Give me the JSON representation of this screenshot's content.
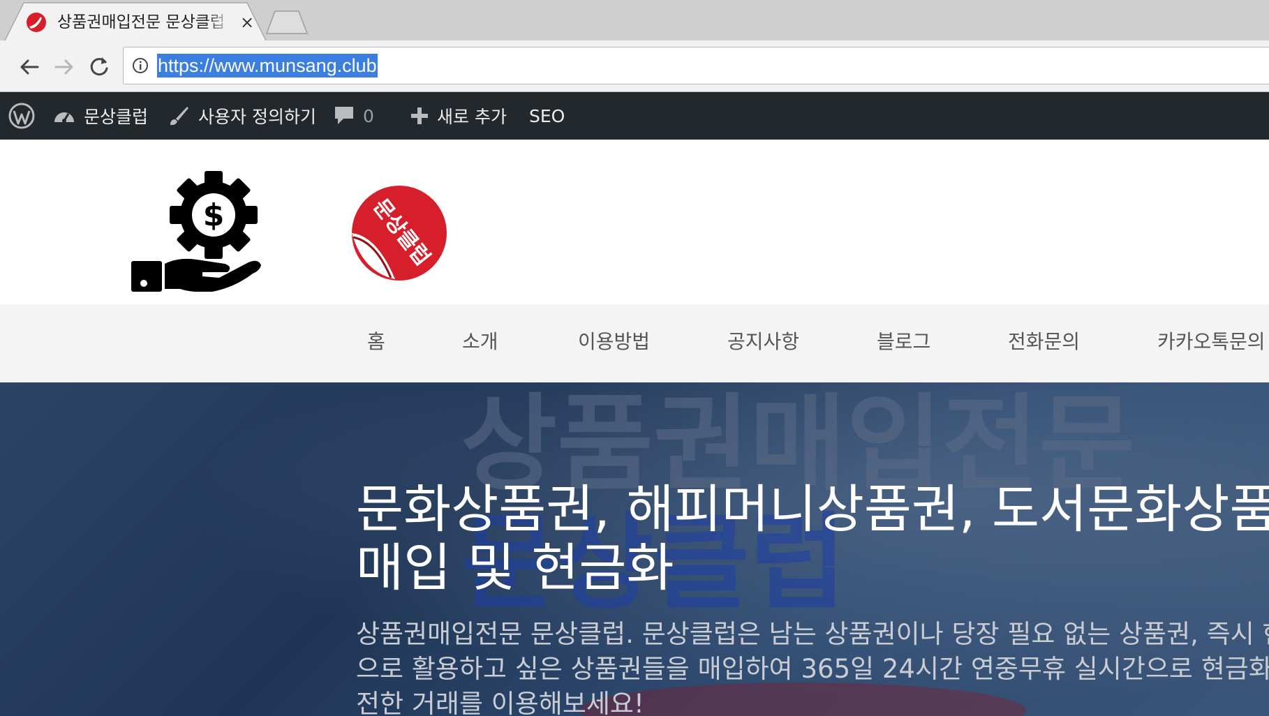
{
  "browser": {
    "tab_title": "상품권매입전문 문상클럽",
    "tab_close": "×",
    "url": "https://www.munsang.club"
  },
  "adminbar": {
    "wp_icon": "wordpress-icon",
    "site_name": "문상클럽",
    "customize": "사용자 정의하기",
    "comments_count": "0",
    "new": "새로 추가",
    "seo": "SEO"
  },
  "header": {
    "logo_icon": "hand-gear-dollar-icon",
    "brand_sticker_text": "문상클럽",
    "brand_color": "#d71f2b"
  },
  "menu": {
    "items": [
      "홈",
      "소개",
      "이용방법",
      "공지사항",
      "블로그",
      "전화문의",
      "카카오톡문의"
    ]
  },
  "hero": {
    "bg_text_1": "상품권매입전문",
    "bg_text_2": "문상클럽",
    "title_line1": "문화상품권, 해피머니상품권, 도서문화상품권",
    "title_line2": "매입 및 현금화",
    "desc_line1": "상품권매입전문 문상클럽. 문상클럽은 남는 상품권이나 당장 필요 없는 상품권, 즉시 현금화 하",
    "desc_line2": "으로 활용하고 싶은 상품권들을 매입하여 365일 24시간 연중무휴 실시간으로 현금화 해드립",
    "desc_line3": "전한 거래를 이용해보세요!"
  },
  "colors": {
    "adminbar_bg": "#23282d",
    "hero_bg": "#24395a",
    "selection": "#3a7ee0"
  }
}
